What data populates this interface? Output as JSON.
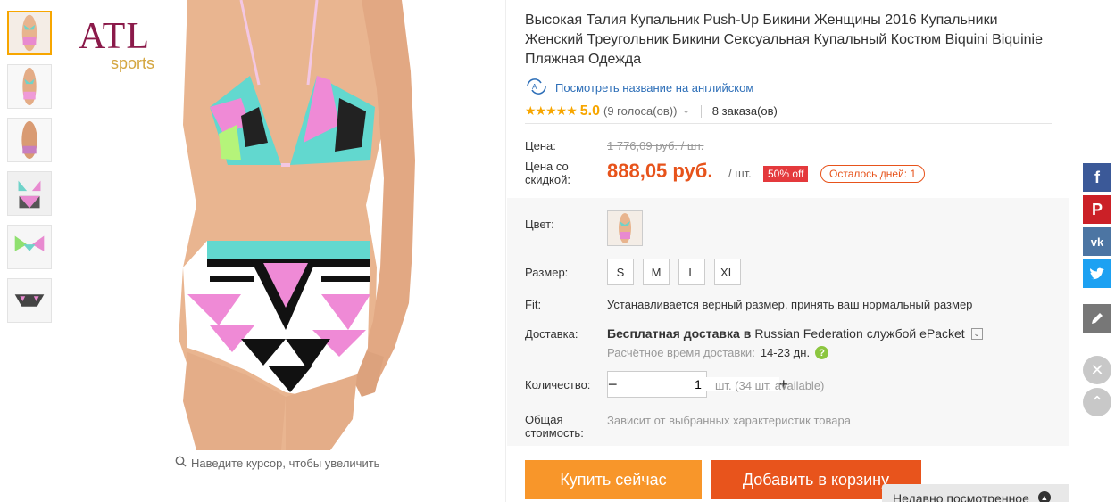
{
  "gallery": {
    "thumbnail_count": 6,
    "zoom_hint": "Наведите курсор, чтобы увеличить"
  },
  "brand_logo": {
    "name": "ATL",
    "sub": "sports"
  },
  "product": {
    "title": "Высокая Талия Купальник Push-Up Бикини Женщины 2016 Купальники Женский Треугольник Бикини Сексуальная Купальный Костюм Biquini Biquinie Пляжная Одежда",
    "translate_link": "Посмотреть название на английском",
    "rating_stars": "★★★★★",
    "rating": "5.0",
    "votes": "(9 голоса(ов))",
    "orders": "8 заказа(ов)"
  },
  "price": {
    "price_label": "Цена:",
    "old_price": "1 776,09 руб. / шт.",
    "discount_label": "Цена со скидкой:",
    "new_price": "888,05 руб.",
    "per_unit": "/ шт.",
    "off_badge": "50% off",
    "days_left": "Осталось дней: 1"
  },
  "options": {
    "color_label": "Цвет:",
    "size_label": "Размер:",
    "sizes": [
      "S",
      "M",
      "L",
      "XL"
    ],
    "fit_label": "Fit:",
    "fit_text": "Устанавливается верный размер, принять ваш нормальный размер",
    "shipping_label": "Доставка:",
    "shipping_free": "Бесплатная доставка в",
    "shipping_country": "Russian Federation",
    "shipping_service": "службой ePacket",
    "shipping_time_label": "Расчётное время доставки:",
    "shipping_days": "14-23 дн.",
    "quantity_label": "Количество:",
    "quantity": "1",
    "quantity_note": "шт. (34 шт. available)",
    "total_label": "Общая стоимость:",
    "total_text": "Зависит от выбранных характеристик товара"
  },
  "actions": {
    "buy_now": "Купить сейчас",
    "add_to_cart": "Добавить в корзину"
  },
  "recently_viewed": "Недавно посмотренное",
  "colors": {
    "accent_orange": "#f8962a",
    "cart_red": "#e8541c",
    "price_orange": "#e7531b",
    "off_red": "#e4393c",
    "link_blue": "#2e6fb8"
  }
}
